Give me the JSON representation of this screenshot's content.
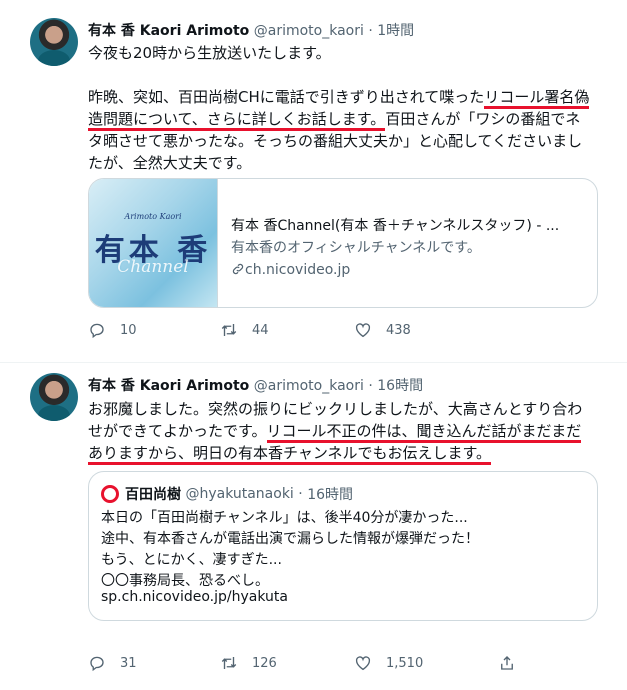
{
  "tweets": [
    {
      "name": "有本 香 Kaori Arimoto",
      "handle": "@arimoto_kaori",
      "sep": "·",
      "time": "1時間",
      "lines": {
        "l1": "今夜も20時から生放送いたします。",
        "l2a": "昨晩、突如、百田尚樹CHに電話で引きずり出されて喋った",
        "l2b": "リコール署名偽",
        "l3a": "造問題について、さらに詳しくお話します。",
        "l3b": "百田さんが「ワシの番組でネ",
        "l4": "タ晒させて悪かったな。そっちの番組大丈夫か」と心配してくださいまし",
        "l5": "たが、全然大丈夫です。"
      },
      "card": {
        "image_sub": "Arimoto Kaori",
        "image_big": "有本 香",
        "image_ch": "Channel",
        "title": "有本 香Channel(有本 香＋チャンネルスタッフ) - ...",
        "desc": "有本香のオフィシャルチャンネルです。",
        "domain": "ch.nicovideo.jp"
      },
      "actions": {
        "replies": "10",
        "retweets": "44",
        "likes": "438"
      }
    },
    {
      "name": "有本 香 Kaori Arimoto",
      "handle": "@arimoto_kaori",
      "sep": "·",
      "time": "16時間",
      "lines": {
        "l1": "お邪魔しました。突然の振りにビックリしましたが、大高さんとすり合わ",
        "l2a": "せができてよかったです。",
        "l2b": "リコール不正の件は、聞き込んだ話がまだまだ",
        "l3": "ありますから、明日の有本香チャンネルでもお伝えします。"
      },
      "quote": {
        "name": "百田尚樹",
        "handle": "@hyakutanaoki",
        "sep": "·",
        "time": "16時間",
        "lines": [
          "本日の「百田尚樹チャンネル」は、後半40分が凄かった...",
          "途中、有本香さんが電話出演で漏らした情報が爆弾だった！",
          "もう、とにかく、凄すぎた...",
          "〇〇事務局長、恐るべし。"
        ],
        "link": "sp.ch.nicovideo.jp/hyakuta"
      },
      "actions": {
        "replies": "31",
        "retweets": "126",
        "likes": "1,510"
      }
    }
  ],
  "icons": [
    "reply-icon",
    "retweet-icon",
    "like-icon",
    "share-icon",
    "link-icon"
  ]
}
